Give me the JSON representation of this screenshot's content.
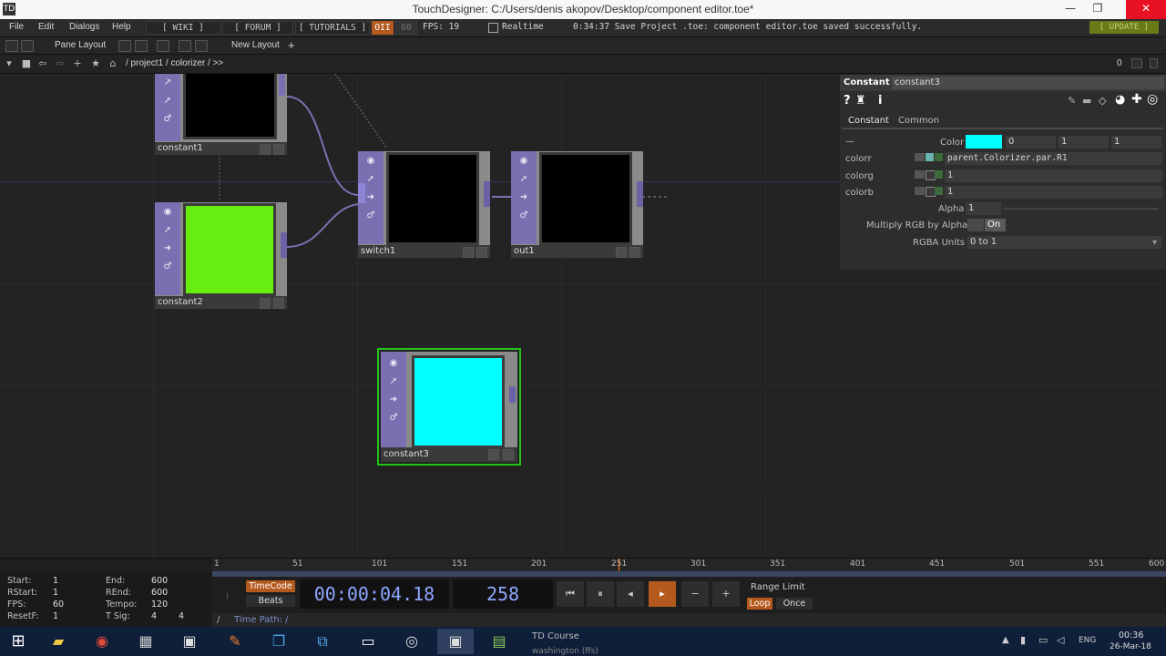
{
  "window": {
    "title": "TouchDesigner: C:/Users/denis akopov/Desktop/component editor.toe*",
    "app_icon": "TD",
    "minimize_icon": "—",
    "maximize_icon": "❐",
    "close_icon": "✕"
  },
  "menubar": {
    "file": "File",
    "edit": "Edit",
    "dialogs": "Dialogs",
    "help": "Help",
    "wiki": "[ WIKI ]",
    "forum": "[ FORUM ]",
    "tutorials": "[ TUTORIALS ]",
    "oii": "OII",
    "fps_cap": "60",
    "fps_label": "FPS:  19",
    "realtime": "Realtime",
    "status": "0:34:37 Save Project .toe: component editor.toe saved successfully.",
    "update": "[ UPDATE ]"
  },
  "panebar": {
    "pane_layout": "Pane Layout",
    "new_layout": "New Layout",
    "add": "+"
  },
  "pathbar": {
    "path": "/ project1 / colorizer / >>",
    "counter": "0"
  },
  "nodes": [
    {
      "label": "constant1",
      "viewer": "#000000"
    },
    {
      "label": "constant2",
      "viewer": "#66ee11"
    },
    {
      "label": "switch1",
      "viewer": "#000000"
    },
    {
      "label": "out1",
      "viewer": "#000000"
    },
    {
      "label": "constant3",
      "viewer": "#00ffff"
    }
  ],
  "params": {
    "op_type": "Constant",
    "op_name": "constant3",
    "tabs": [
      "Constant",
      "Common"
    ],
    "color_label": "Color",
    "color_swatch": "#00ffff",
    "color_values": [
      "0",
      "1",
      "1"
    ],
    "colorr_label": "colorr",
    "colorr_value": "parent.Colorizer.par.R1",
    "colorg_label": "colorg",
    "colorg_value": "1",
    "colorb_label": "colorb",
    "colorb_value": "1",
    "alpha_label": "Alpha",
    "alpha_value": "1",
    "premult_label": "Multiply RGB by Alpha",
    "premult_value": "On",
    "units_label": "RGBA Units",
    "units_value": "0 to 1"
  },
  "timeline": {
    "ticks": [
      "1",
      "51",
      "101",
      "151",
      "201",
      "251",
      "301",
      "351",
      "401",
      "451",
      "501",
      "551",
      "600"
    ],
    "start_label": "Start:",
    "start": "1",
    "end_label": "End:",
    "end": "600",
    "rstart_label": "RStart:",
    "rstart": "1",
    "rend_label": "REnd:",
    "rend": "600",
    "fps_label": "FPS:",
    "fps": "60",
    "tempo_label": "Tempo:",
    "tempo": "120",
    "resetf_label": "ResetF:",
    "resetf": "1",
    "tsig_label": "T Sig:",
    "tsig_a": "4",
    "tsig_b": "4",
    "timecode_btn": "TimeCode",
    "beats_btn": "Beats",
    "timecode": "00:00:04.18",
    "frame": "258",
    "range_limit": "Range Limit",
    "loop": "Loop",
    "once": "Once",
    "time_path": "Time Path: /"
  },
  "taskbar": {
    "td_course": "TD Course",
    "td_course_sub": "washington (ffs)",
    "lang": "ENG",
    "time": "00:36",
    "date": "26-Mar-18"
  }
}
